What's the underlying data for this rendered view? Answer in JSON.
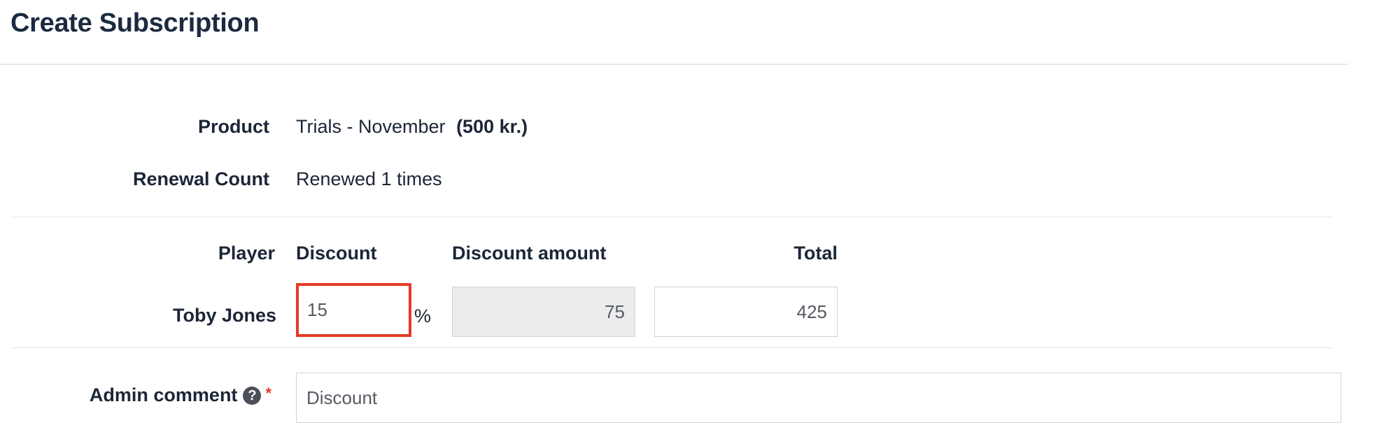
{
  "page": {
    "title": "Create Subscription"
  },
  "info": {
    "product_label": "Product",
    "product_name": "Trials - November",
    "product_price": "(500 kr.)",
    "renewal_label": "Renewal Count",
    "renewal_value": "Renewed 1 times"
  },
  "table": {
    "headers": {
      "player": "Player",
      "discount": "Discount",
      "discount_amount": "Discount amount",
      "total": "Total"
    },
    "rows": [
      {
        "player": "Toby Jones",
        "discount": "15",
        "discount_unit": "%",
        "discount_amount": "75",
        "total": "425"
      }
    ]
  },
  "comment": {
    "label": "Admin comment",
    "required_mark": "*",
    "help_icon": "question-circle-icon",
    "value": "Discount"
  },
  "colors": {
    "highlight": "#e53a26",
    "required": "#e53a26",
    "readonly_bg": "#ececec"
  }
}
